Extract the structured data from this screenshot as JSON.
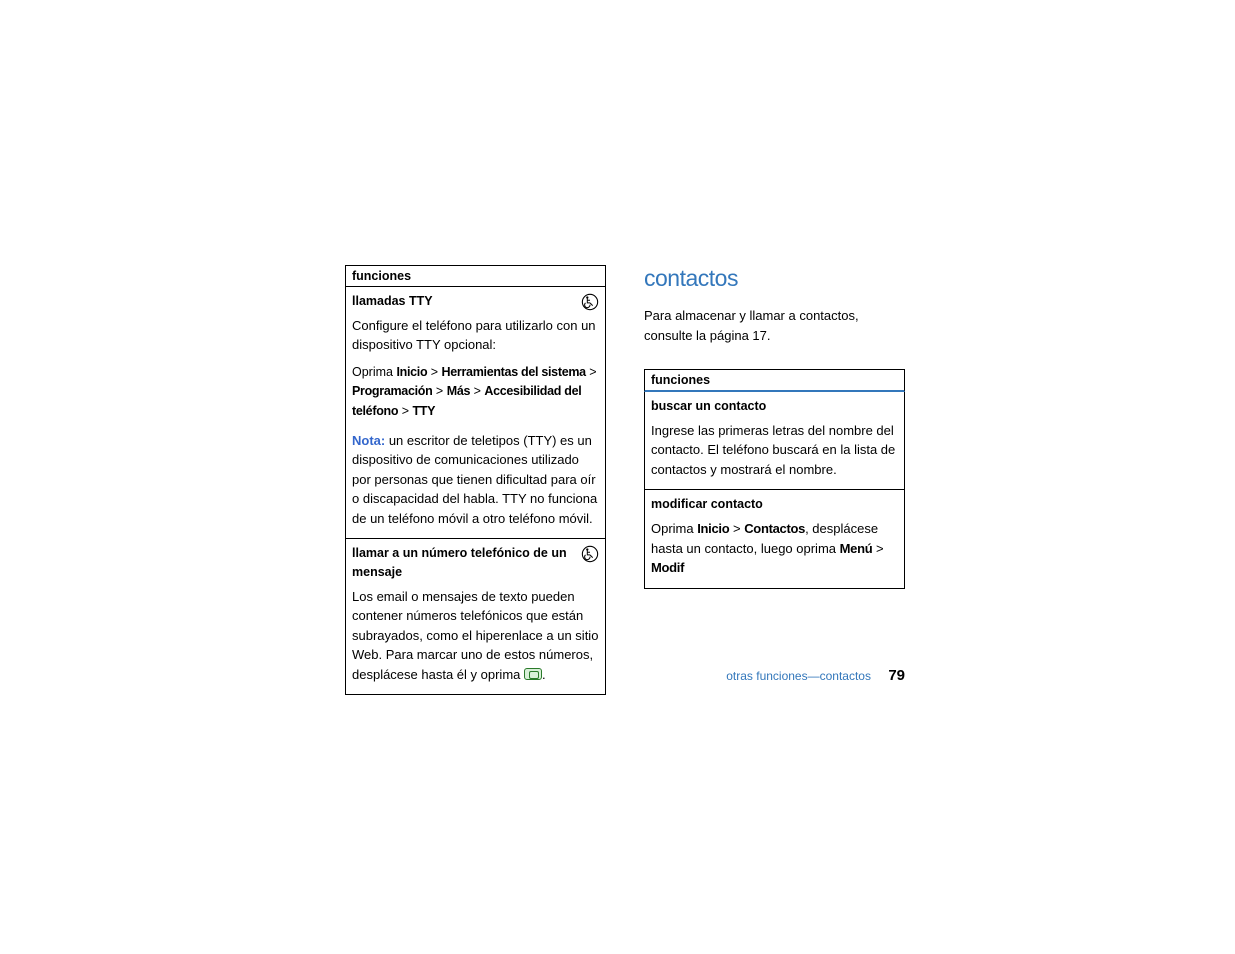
{
  "left_col": {
    "header": "funciones",
    "rows": [
      {
        "title": "llamadas TTY",
        "has_icon": true,
        "intro": "Configure el teléfono para utilizarlo con un dispositivo TTY opcional:",
        "path_prefix": "Oprima ",
        "path_parts": [
          "Inicio",
          "Herramientas del sistema",
          "Programación",
          "Más",
          "Accesibilidad del teléfono",
          "TTY"
        ],
        "note_label": "Nota:",
        "note_body": " un escritor de teletipos (TTY) es un dispositivo de comunicaciones utilizado por personas que tienen dificultad para oír o discapacidad del habla. TTY no funciona de un teléfono móvil a otro teléfono móvil."
      },
      {
        "title": "llamar a un número telefónico de un mensaje",
        "has_icon": true,
        "body": "Los email o mensajes de texto pueden contener números telefónicos que están subrayados, como el hiperenlace a un sitio Web. Para marcar uno de estos números, desplácese hasta él y oprima ",
        "has_green_key": true,
        "trailing": "."
      }
    ]
  },
  "right_col": {
    "heading": "contactos",
    "intro": "Para almacenar y llamar a contactos, consulte la página 17.",
    "header": "funciones",
    "rows": [
      {
        "title": "buscar un contacto",
        "body": "Ingrese las primeras letras del nombre del contacto. El teléfono buscará en la lista de contactos y mostrará el nombre."
      },
      {
        "title": "modificar contacto",
        "path_prefix": "Oprima ",
        "path_kw1": "Inicio",
        "path_sep1": " > ",
        "path_kw2": "Contactos",
        "mid": ", desplácese hasta un contacto, luego oprima ",
        "path_kw3": "Menú",
        "path_sep2": " > ",
        "path_kw4": "Modif"
      }
    ]
  },
  "footer": {
    "text": "otras funciones—contactos",
    "page": "79"
  }
}
